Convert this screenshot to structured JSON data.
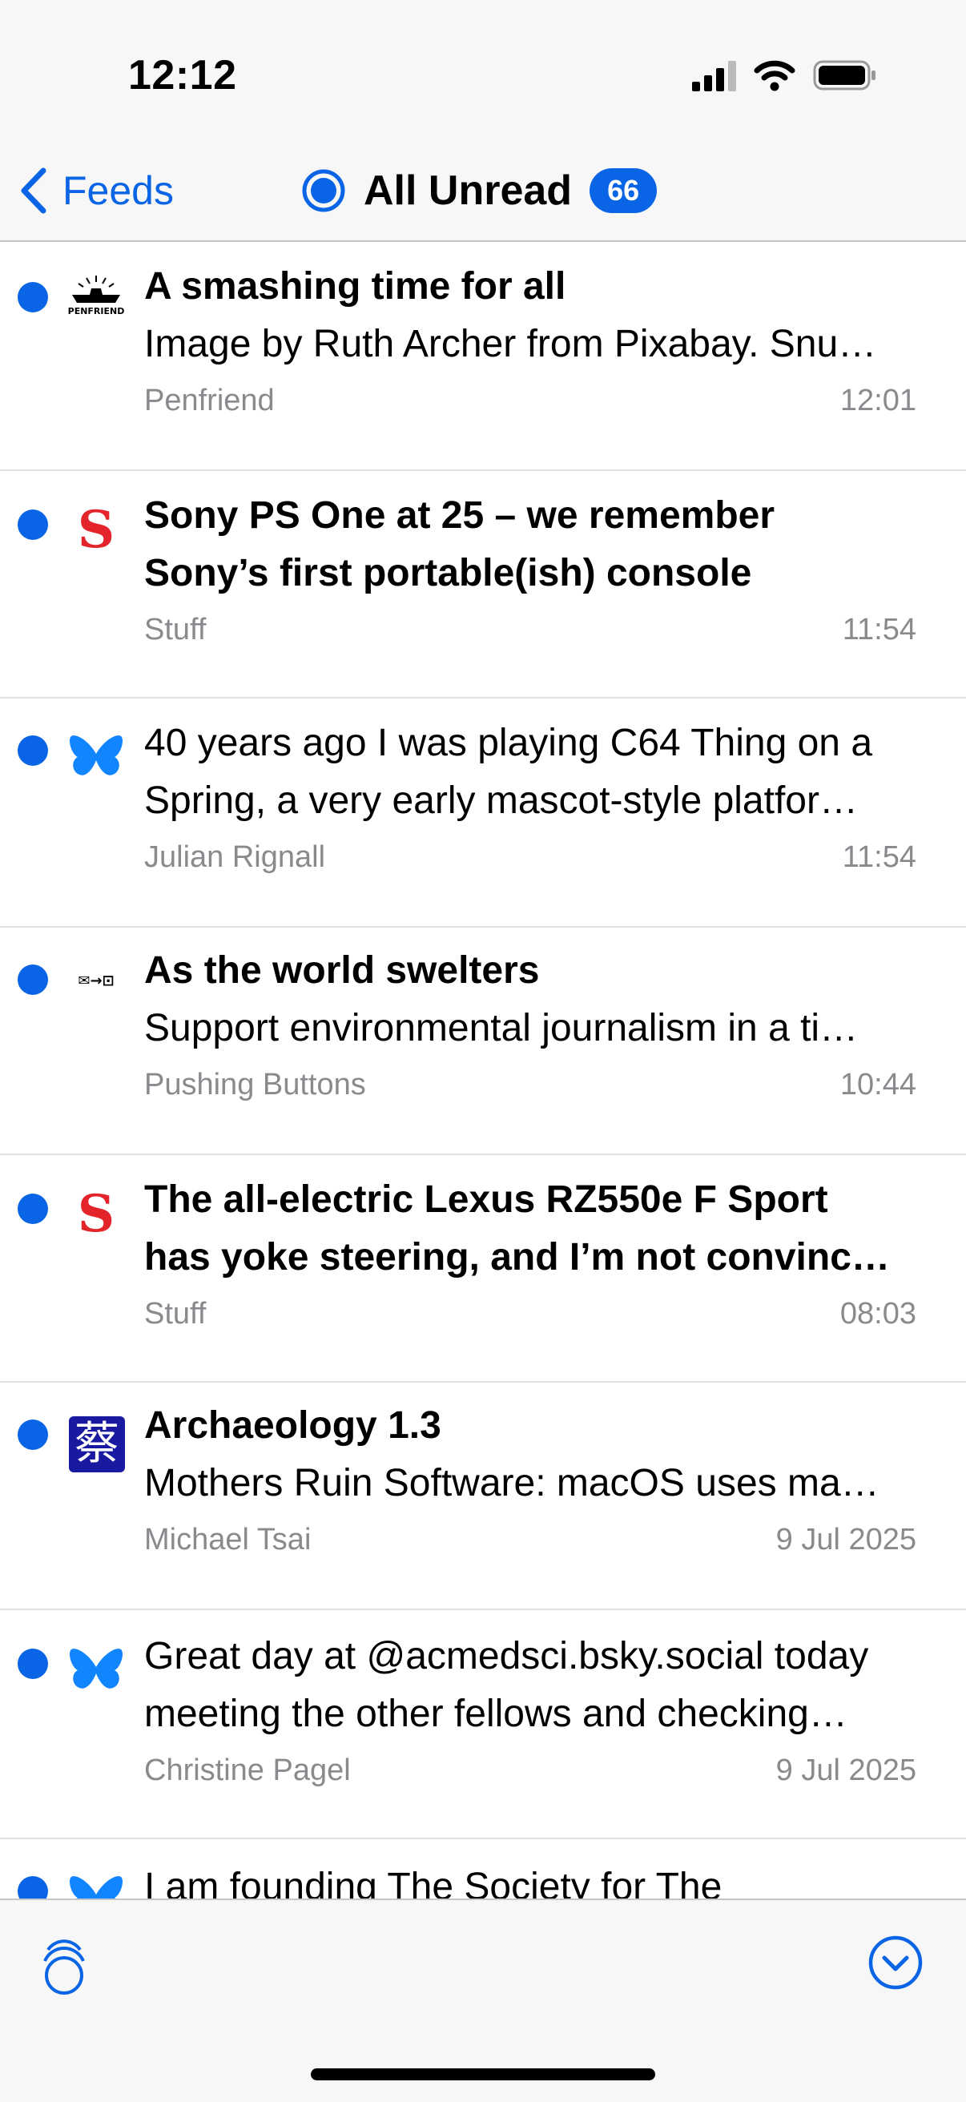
{
  "status_bar": {
    "time": "12:12"
  },
  "nav": {
    "back_label": "Feeds",
    "title": "All Unread",
    "unread_count": "66"
  },
  "accent_color": "#0a64e6",
  "articles": [
    {
      "icon": "penfriend-logo-icon",
      "icon_text": "PENFRIEND",
      "title": "A smashing time for all",
      "summary": "Image by Ruth Archer from Pixabay. Snu…",
      "source": "Penfriend",
      "time": "12:01"
    },
    {
      "icon": "stuff-logo-icon",
      "icon_text": "S",
      "title_line1": "Sony PS One at 25 – we remember",
      "title_line2": "Sony’s first portable(ish) console",
      "source": "Stuff",
      "time": "11:54"
    },
    {
      "icon": "bluesky-butterfly-icon",
      "text_line1": "40 years ago I was playing C64 Thing on a",
      "text_line2": "Spring, a very early mascot-style platfor…",
      "source": "Julian Rignall",
      "time": "11:54"
    },
    {
      "icon": "pushing-buttons-logo-icon",
      "icon_text": "✉→⊡",
      "title": "As the world swelters",
      "summary": "Support environmental journalism in a ti…",
      "source": "Pushing Buttons",
      "time": "10:44"
    },
    {
      "icon": "stuff-logo-icon",
      "icon_text": "S",
      "title_line1": "The all-electric Lexus RZ550e F Sport",
      "title_line2": "has yoke steering, and I’m not convinc…",
      "source": "Stuff",
      "time": "08:03"
    },
    {
      "icon": "michael-tsai-logo-icon",
      "icon_text": "蔡",
      "title": "Archaeology 1.3",
      "summary": "Mothers Ruin Software: macOS uses ma…",
      "source": "Michael Tsai",
      "time": "9 Jul 2025"
    },
    {
      "icon": "bluesky-butterfly-icon",
      "text_line1": "Great day at @acmedsci.bsky.social today",
      "text_line2": "meeting the other fellows and checking…",
      "source": "Christine Pagel",
      "time": "9 Jul 2025"
    },
    {
      "icon": "bluesky-butterfly-icon",
      "text_line1": "I am founding The Society for The"
    }
  ],
  "toolbar": {
    "left_icon": "mark-all-read-icon",
    "right_icon": "next-unread-icon"
  }
}
